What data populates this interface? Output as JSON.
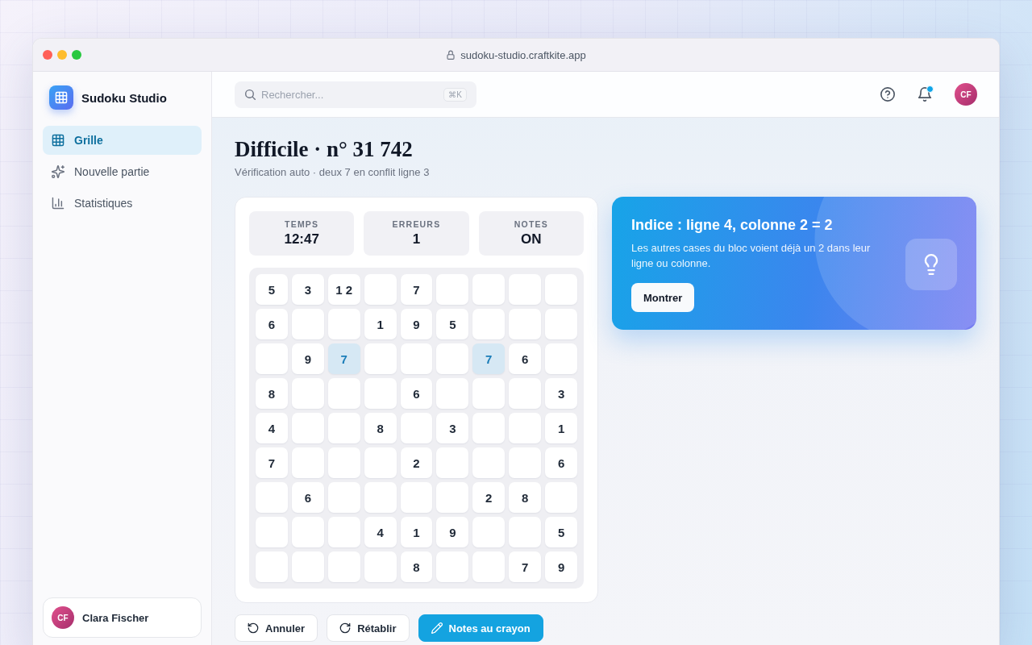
{
  "browser": {
    "url": "sudoku-studio.craftkite.app"
  },
  "sidebar": {
    "app_name": "Sudoku Studio",
    "items": [
      {
        "label": "Grille",
        "selected": true
      },
      {
        "label": "Nouvelle partie",
        "selected": false
      },
      {
        "label": "Statistiques",
        "selected": false
      }
    ],
    "user": {
      "initials": "CF",
      "name": "Clara Fischer"
    }
  },
  "topbar": {
    "search": {
      "placeholder": "Rechercher...",
      "shortcut": "⌘K"
    },
    "notifications": {
      "unread": true
    },
    "avatar": "CF"
  },
  "page": {
    "title": "Difficile · n° 31 742",
    "subtitle": "Vérification auto · deux 7 en conflit ligne 3"
  },
  "stats": [
    {
      "label": "TEMPS",
      "value": "12:47"
    },
    {
      "label": "ERREURS",
      "value": "1"
    },
    {
      "label": "NOTES",
      "value": "ON"
    }
  ],
  "board": {
    "rows": [
      [
        {
          "value": "5",
          "conflict": false
        },
        {
          "value": "3",
          "conflict": false
        },
        {
          "value": "1 2",
          "conflict": false
        },
        {
          "conflict": false
        },
        {
          "value": "7",
          "conflict": false
        },
        {
          "conflict": false
        },
        {
          "conflict": false
        },
        {
          "conflict": false
        },
        {
          "conflict": false
        }
      ],
      [
        {
          "value": "6",
          "conflict": false
        },
        {
          "conflict": false
        },
        {
          "conflict": false
        },
        {
          "value": "1",
          "conflict": false
        },
        {
          "value": "9",
          "conflict": false
        },
        {
          "value": "5",
          "conflict": false
        },
        {
          "conflict": false
        },
        {
          "conflict": false
        },
        {
          "conflict": false
        }
      ],
      [
        {
          "conflict": false
        },
        {
          "value": "9",
          "conflict": false
        },
        {
          "value": "7",
          "conflict": true
        },
        {
          "conflict": false
        },
        {
          "conflict": false
        },
        {
          "conflict": false
        },
        {
          "value": "7",
          "conflict": true
        },
        {
          "value": "6",
          "conflict": false
        },
        {
          "conflict": false
        }
      ],
      [
        {
          "value": "8",
          "conflict": false
        },
        {
          "conflict": false
        },
        {
          "conflict": false
        },
        {
          "conflict": false
        },
        {
          "value": "6",
          "conflict": false
        },
        {
          "conflict": false
        },
        {
          "conflict": false
        },
        {
          "conflict": false
        },
        {
          "value": "3",
          "conflict": false
        }
      ],
      [
        {
          "value": "4",
          "conflict": false
        },
        {
          "conflict": false
        },
        {
          "conflict": false
        },
        {
          "value": "8",
          "conflict": false
        },
        {
          "conflict": false
        },
        {
          "value": "3",
          "conflict": false
        },
        {
          "conflict": false
        },
        {
          "conflict": false
        },
        {
          "value": "1",
          "conflict": false
        }
      ],
      [
        {
          "value": "7",
          "conflict": false
        },
        {
          "conflict": false
        },
        {
          "conflict": false
        },
        {
          "conflict": false
        },
        {
          "value": "2",
          "conflict": false
        },
        {
          "conflict": false
        },
        {
          "conflict": false
        },
        {
          "conflict": false
        },
        {
          "value": "6",
          "conflict": false
        }
      ],
      [
        {
          "conflict": false
        },
        {
          "value": "6",
          "conflict": false
        },
        {
          "conflict": false
        },
        {
          "conflict": false
        },
        {
          "conflict": false
        },
        {
          "conflict": false
        },
        {
          "value": "2",
          "conflict": false
        },
        {
          "value": "8",
          "conflict": false
        },
        {
          "conflict": false
        }
      ],
      [
        {
          "conflict": false
        },
        {
          "conflict": false
        },
        {
          "conflict": false
        },
        {
          "value": "4",
          "conflict": false
        },
        {
          "value": "1",
          "conflict": false
        },
        {
          "value": "9",
          "conflict": false
        },
        {
          "conflict": false
        },
        {
          "conflict": false
        },
        {
          "value": "5",
          "conflict": false
        }
      ],
      [
        {
          "conflict": false
        },
        {
          "conflict": false
        },
        {
          "conflict": false
        },
        {
          "conflict": false
        },
        {
          "value": "8",
          "conflict": false
        },
        {
          "conflict": false
        },
        {
          "conflict": false
        },
        {
          "value": "7",
          "conflict": false
        },
        {
          "value": "9",
          "conflict": false
        }
      ]
    ]
  },
  "hint": {
    "title": "Indice : ligne 4, colonne 2 = 2",
    "text": "Les autres cases du bloc voient déjà un 2 dans leur ligne ou colonne.",
    "button": "Montrer"
  },
  "actions": [
    {
      "label": "Annuler",
      "active": false
    },
    {
      "label": "Rétablir",
      "active": false
    },
    {
      "label": "Notes au crayon",
      "active": true
    }
  ]
}
